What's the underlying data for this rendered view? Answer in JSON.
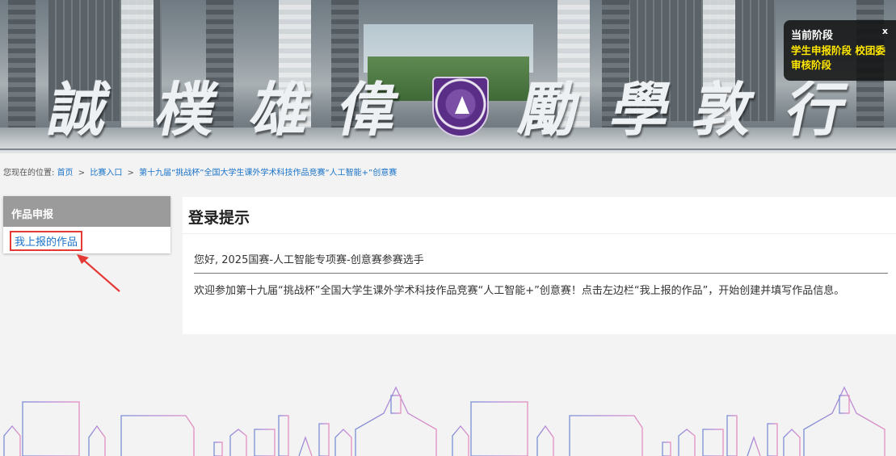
{
  "banner": {
    "calligraphy": [
      "誠",
      "樸",
      "雄",
      "偉",
      "勵",
      "學",
      "敦",
      "行"
    ]
  },
  "stage_popup": {
    "title": "当前阶段",
    "close_label": "x",
    "value_line1": "学生申报阶段 校团委",
    "value_line2": "审核阶段"
  },
  "breadcrumb": {
    "prefix": "您现在的位置:",
    "items": [
      "首页",
      "比赛入口",
      "第十九届“挑战杯”全国大学生课外学术科技作品竞赛“人工智能+”创意赛"
    ],
    "separator": ">"
  },
  "sidebar": {
    "title": "作品申报",
    "items": [
      {
        "label": "我上报的作品"
      }
    ]
  },
  "main": {
    "title": "登录提示",
    "greeting": "您好, 2025国赛-人工智能专项赛-创意赛参赛选手",
    "message": "欢迎参加第十九届“挑战杯”全国大学生课外学术科技作品竞赛“人工智能+”创意赛！点击左边栏“我上报的作品”，开始创建并填写作品信息。"
  },
  "colors": {
    "link": "#1a73c9",
    "highlight": "#e53935",
    "stage_text": "#ffe600",
    "sidebar_head": "#9b9b9b"
  }
}
